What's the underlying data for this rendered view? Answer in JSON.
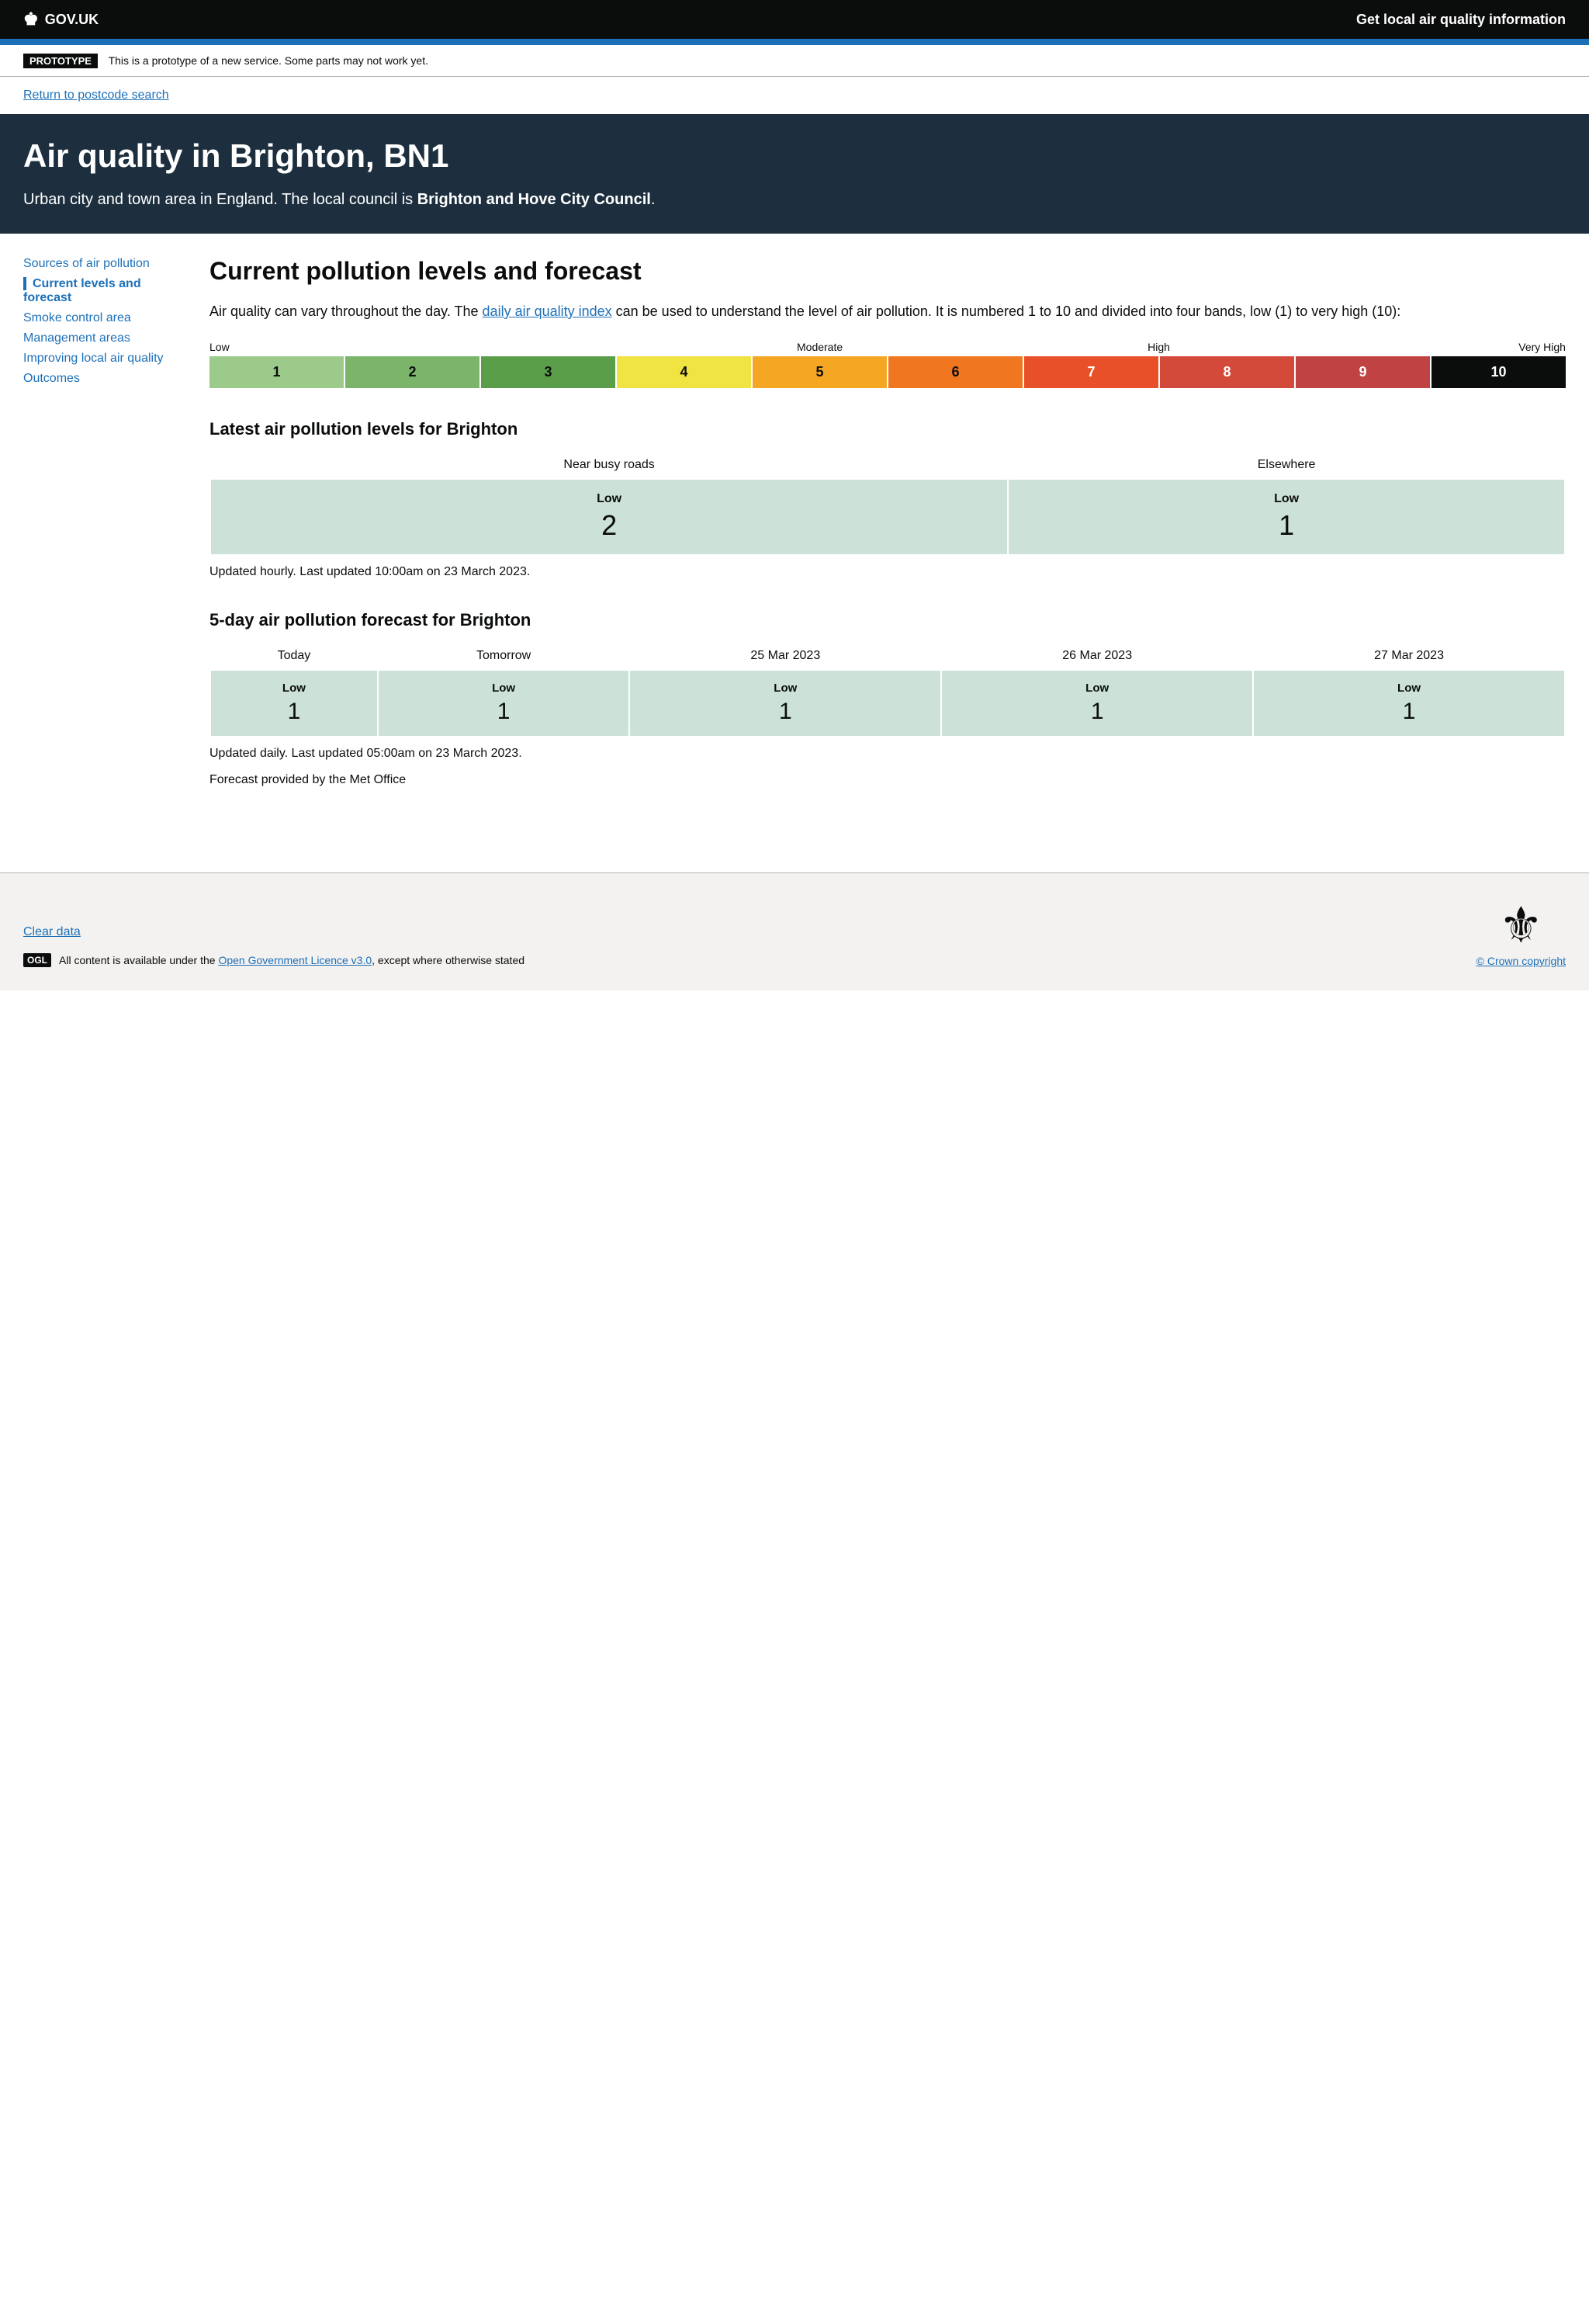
{
  "header": {
    "logo_text": "GOV.UK",
    "title": "Get local air quality information"
  },
  "prototype_banner": {
    "badge": "PROTOTYPE",
    "message": "This is a prototype of a new service. Some parts may not work yet."
  },
  "back_link": {
    "label": "Return to postcode search"
  },
  "page_header": {
    "title": "Air quality in Brighton, BN1",
    "description_part1": "Urban city and town area in England. The local council is ",
    "council_name": "Brighton and Hove City Council",
    "description_end": "."
  },
  "sidebar": {
    "items": [
      {
        "label": "Sources of air pollution",
        "active": false
      },
      {
        "label": "Current levels and forecast",
        "active": true
      },
      {
        "label": "Smoke control area",
        "active": false
      },
      {
        "label": "Management areas",
        "active": false
      },
      {
        "label": "Improving local air quality",
        "active": false
      },
      {
        "label": "Outcomes",
        "active": false
      }
    ]
  },
  "content": {
    "main_heading": "Current pollution levels and forecast",
    "intro_text_before_link": "Air quality can vary throughout the day. The ",
    "intro_link_text": "daily air quality index",
    "intro_text_after_link": " can be used to understand the level of air pollution. It is numbered 1 to 10 and divided into four bands, low (1) to very high (10):",
    "aqi_scale": {
      "bands": [
        {
          "label": "Low",
          "boxes": [
            1,
            2,
            3
          ]
        },
        {
          "label": "Moderate",
          "boxes": [
            4,
            5,
            6
          ]
        },
        {
          "label": "High",
          "boxes": [
            7,
            8
          ]
        },
        {
          "label": "Very High",
          "boxes": [
            9,
            10
          ]
        }
      ]
    },
    "latest_heading": "Latest air pollution levels for Brighton",
    "latest_table": {
      "col1_header": "Near busy roads",
      "col2_header": "Elsewhere",
      "col1_band": "Low",
      "col1_value": "2",
      "col2_band": "Low",
      "col2_value": "1"
    },
    "latest_update_text": "Updated hourly. Last updated 10:00am on 23 March 2023.",
    "forecast_heading": "5-day air pollution forecast for Brighton",
    "forecast_table": {
      "columns": [
        {
          "header": "Today",
          "band": "Low",
          "value": "1"
        },
        {
          "header": "Tomorrow",
          "band": "Low",
          "value": "1"
        },
        {
          "header": "25 Mar 2023",
          "band": "Low",
          "value": "1"
        },
        {
          "header": "26 Mar 2023",
          "band": "Low",
          "value": "1"
        },
        {
          "header": "27 Mar 2023",
          "band": "Low",
          "value": "1"
        }
      ]
    },
    "forecast_update_text": "Updated daily. Last updated 05:00am on 23 March 2023.",
    "forecast_provider_text": "Forecast provided by the Met Office"
  },
  "footer": {
    "clear_data_label": "Clear data",
    "ogl_badge": "OGL",
    "ogl_text_before": "All content is available under the ",
    "ogl_link_text": "Open Government Licence v3.0",
    "ogl_text_after": ", except where otherwise stated",
    "crown_copyright_text": "© Crown copyright"
  }
}
